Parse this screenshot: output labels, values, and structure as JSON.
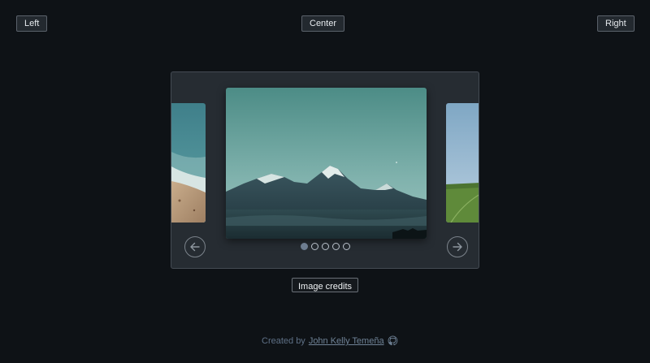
{
  "controls": {
    "left_label": "Left",
    "center_label": "Center",
    "right_label": "Right"
  },
  "carousel": {
    "slides": [
      {
        "icon": "beach-shore-image"
      },
      {
        "icon": "mountain-landscape-image"
      },
      {
        "icon": "green-field-image"
      }
    ],
    "prev_icon": "arrow-left-icon",
    "next_icon": "arrow-right-icon",
    "dot_count": 5,
    "active_dot": 1
  },
  "credits_button_label": "Image credits",
  "footer": {
    "prefix": "Created by",
    "author": "John Kelly Temeña",
    "icon": "github-icon"
  },
  "colors": {
    "background": "#0e1216",
    "panel": "#262c32",
    "active_dot": "#6d7d90",
    "link": "#6f8296"
  }
}
